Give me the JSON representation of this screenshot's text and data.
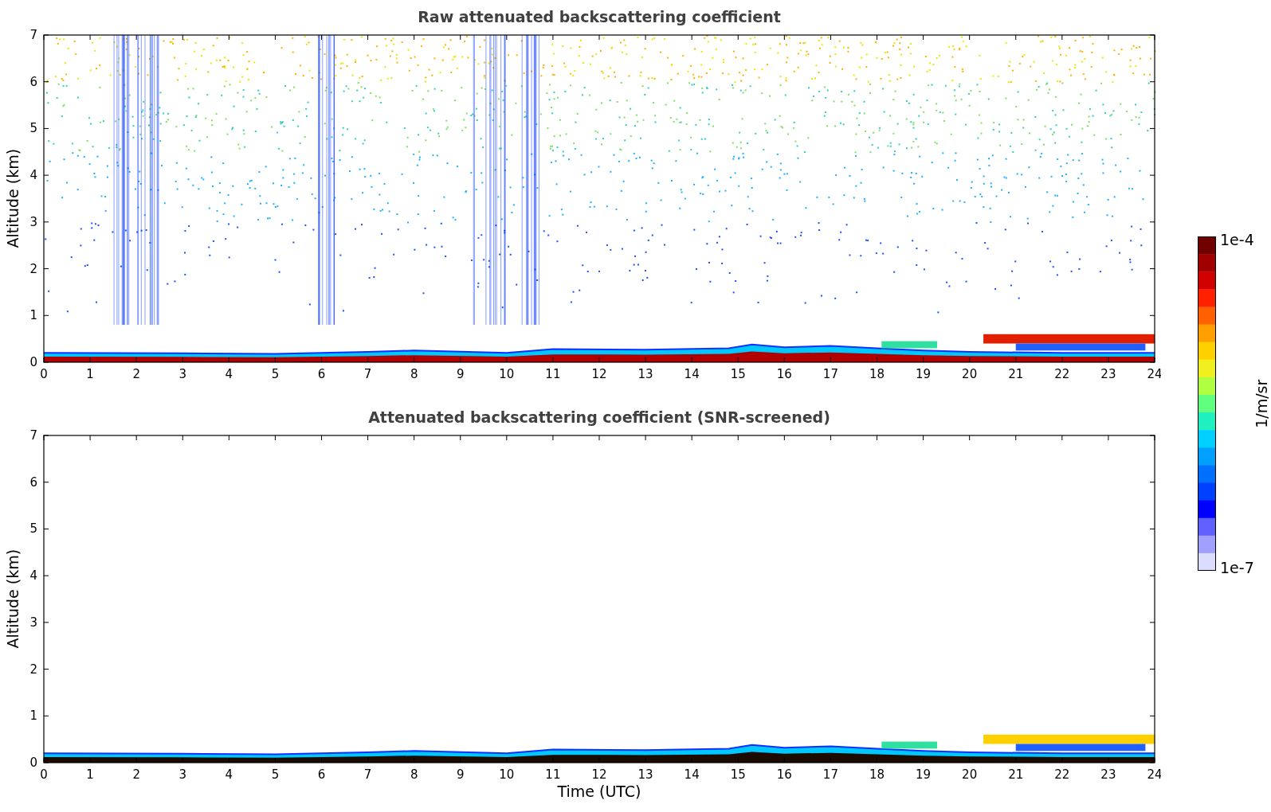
{
  "panels": [
    {
      "kind": "raw",
      "title": "Raw attenuated backscattering coefficient",
      "ylabel": "Altitude (km)",
      "yticks": [
        "7",
        "6",
        "5",
        "4",
        "3",
        "2",
        "1",
        "0"
      ],
      "xticks": [
        "0",
        "1",
        "2",
        "3",
        "4",
        "5",
        "6",
        "7",
        "8",
        "9",
        "10",
        "11",
        "12",
        "13",
        "14",
        "15",
        "16",
        "17",
        "18",
        "19",
        "20",
        "21",
        "22",
        "23",
        "24"
      ]
    },
    {
      "kind": "screened",
      "title": "Attenuated backscattering coefficient (SNR-screened)",
      "ylabel": "Altitude (km)",
      "yticks": [
        "7",
        "6",
        "5",
        "4",
        "3",
        "2",
        "1",
        "0"
      ],
      "xticks": [
        "0",
        "1",
        "2",
        "3",
        "4",
        "5",
        "6",
        "7",
        "8",
        "9",
        "10",
        "11",
        "12",
        "13",
        "14",
        "15",
        "16",
        "17",
        "18",
        "19",
        "20",
        "21",
        "22",
        "23",
        "24"
      ],
      "xlabel": "Time (UTC)"
    }
  ],
  "colorbar": {
    "top_label": "1e-4",
    "bottom_label": "1e-7",
    "unit": "1/m/sr"
  }
}
